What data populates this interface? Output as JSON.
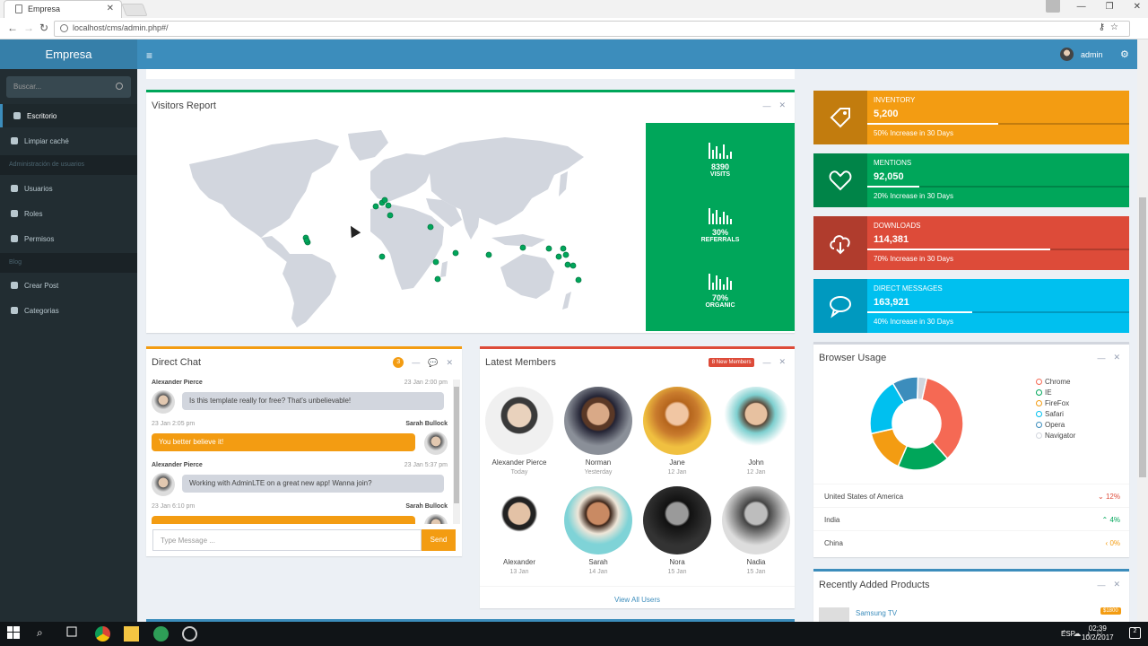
{
  "browser": {
    "tab_title": "Empresa",
    "url": "localhost/cms/admin.php#/"
  },
  "app": {
    "logo": "Empresa",
    "user": "admin"
  },
  "sidebar": {
    "search_placeholder": "Buscar...",
    "items": [
      {
        "label": "Escritorio",
        "icon": "dashboard-icon",
        "active": true
      },
      {
        "label": "Limpiar caché",
        "icon": "cogs-icon"
      },
      {
        "header": "Administración de usuarios"
      },
      {
        "label": "Usuarios",
        "icon": "user-icon"
      },
      {
        "label": "Roles",
        "icon": "users-icon"
      },
      {
        "label": "Permisos",
        "icon": "users-icon"
      },
      {
        "header": "Blog"
      },
      {
        "label": "Crear Post",
        "icon": "plus-icon"
      },
      {
        "label": "Categorias",
        "icon": "folder-icon"
      }
    ]
  },
  "visitors": {
    "title": "Visitors Report",
    "stats": [
      {
        "value": "8390",
        "label": "VISITS"
      },
      {
        "value": "30%",
        "label": "REFERRALS"
      },
      {
        "value": "70%",
        "label": "ORGANIC"
      }
    ]
  },
  "info_boxes": [
    {
      "label": "INVENTORY",
      "number": "5,200",
      "progress": 0.5,
      "desc": "50% Increase in 30 Days",
      "color": "#f39c12",
      "icon": "tag-icon"
    },
    {
      "label": "MENTIONS",
      "number": "92,050",
      "progress": 0.2,
      "desc": "20% Increase in 30 Days",
      "color": "#00a65a",
      "icon": "heart-icon"
    },
    {
      "label": "DOWNLOADS",
      "number": "114,381",
      "progress": 0.7,
      "desc": "70% Increase in 30 Days",
      "color": "#dd4b39",
      "icon": "cloud-download-icon"
    },
    {
      "label": "DIRECT MESSAGES",
      "number": "163,921",
      "progress": 0.4,
      "desc": "40% Increase in 30 Days",
      "color": "#00c0ef",
      "icon": "comment-icon"
    }
  ],
  "chat": {
    "title": "Direct Chat",
    "badge": "3",
    "messages": [
      {
        "name": "Alexander Pierce",
        "time": "23 Jan 2:00 pm",
        "text": "Is this template really for free? That's unbelievable!",
        "side": "left"
      },
      {
        "name": "Sarah Bullock",
        "time": "23 Jan 2:05 pm",
        "text": "You better believe it!",
        "side": "right"
      },
      {
        "name": "Alexander Pierce",
        "time": "23 Jan 5:37 pm",
        "text": "Working with AdminLTE on a great new app! Wanna join?",
        "side": "left"
      },
      {
        "name": "Sarah Bullock",
        "time": "23 Jan 6:10 pm",
        "text": "",
        "side": "right"
      }
    ],
    "input_placeholder": "Type Message ...",
    "send_label": "Send"
  },
  "members": {
    "title": "Latest Members",
    "badge": "8 New Members",
    "list": [
      {
        "name": "Alexander Pierce",
        "date": "Today"
      },
      {
        "name": "Norman",
        "date": "Yesterday"
      },
      {
        "name": "Jane",
        "date": "12 Jan"
      },
      {
        "name": "John",
        "date": "12 Jan"
      },
      {
        "name": "Alexander",
        "date": "13 Jan"
      },
      {
        "name": "Sarah",
        "date": "14 Jan"
      },
      {
        "name": "Nora",
        "date": "15 Jan"
      },
      {
        "name": "Nadia",
        "date": "15 Jan"
      }
    ],
    "view_all": "View All Users"
  },
  "browser_usage": {
    "title": "Browser Usage",
    "legend": [
      {
        "name": "Chrome",
        "color": "#f56954"
      },
      {
        "name": "IE",
        "color": "#00a65a"
      },
      {
        "name": "FireFox",
        "color": "#f39c12"
      },
      {
        "name": "Safari",
        "color": "#00c0ef"
      },
      {
        "name": "Opera",
        "color": "#3c8dbc"
      },
      {
        "name": "Navigator",
        "color": "#d2d6de"
      }
    ],
    "countries": [
      {
        "name": "United States of America",
        "percent": "12%",
        "trend": "down",
        "color": "#dd4b39"
      },
      {
        "name": "India",
        "percent": "4%",
        "trend": "up",
        "color": "#00a65a"
      },
      {
        "name": "China",
        "percent": "0%",
        "trend": "left",
        "color": "#f39c12"
      }
    ]
  },
  "chart_data": {
    "type": "pie",
    "categories": [
      "Chrome",
      "IE",
      "FireFox",
      "Safari",
      "Opera",
      "Navigator"
    ],
    "values": [
      35,
      18,
      15,
      20,
      9,
      3
    ],
    "title": ""
  },
  "products": {
    "title": "Recently Added Products",
    "item_name": "Samsung TV",
    "item_price": "$1800"
  },
  "taskbar": {
    "lang": "ESP",
    "time": "02:39",
    "date": "10/2/2017",
    "notifications": "2"
  }
}
